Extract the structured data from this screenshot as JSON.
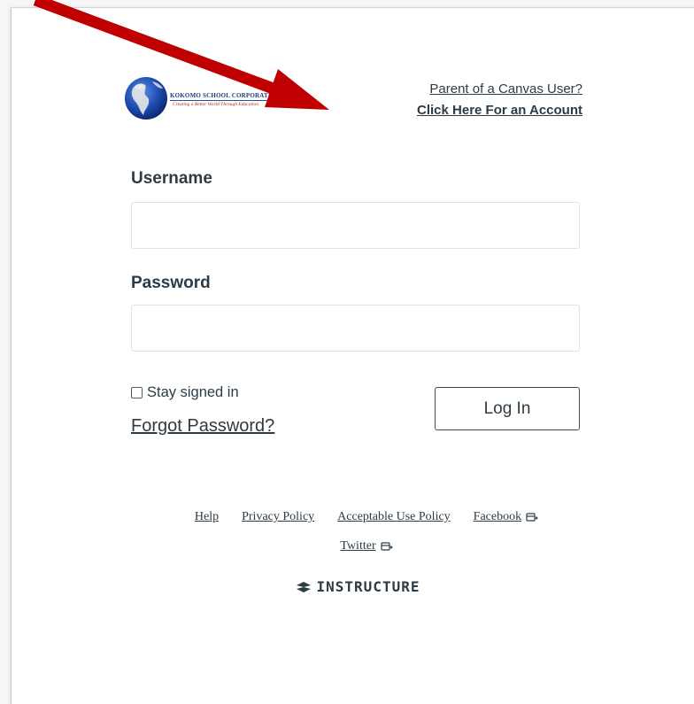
{
  "logo": {
    "name": "KOKOMO SCHOOL CORPORATION",
    "tagline": "Creating a Better World Through Education"
  },
  "parent": {
    "question": "Parent of a Canvas User?",
    "link": "Click Here For an Account"
  },
  "form": {
    "username_label": "Username",
    "username_value": "",
    "password_label": "Password",
    "password_value": "",
    "stay_signed_in": "Stay signed in",
    "stay_signed_in_checked": false,
    "forgot_password": "Forgot Password?",
    "login_button": "Log In"
  },
  "footer": {
    "links": [
      "Help",
      "Privacy Policy",
      "Acceptable Use Policy",
      "Facebook"
    ],
    "second_row": [
      "Twitter"
    ],
    "brand": "INSTRUCTURE"
  },
  "icons": {
    "logo": "globe-icon",
    "external": "external-link-icon",
    "brand": "instructure-logo-icon",
    "annotation": "red-arrow-annotation"
  },
  "colors": {
    "text": "#2d3b45",
    "arrow": "#c00000",
    "border": "#e2e2e2"
  }
}
